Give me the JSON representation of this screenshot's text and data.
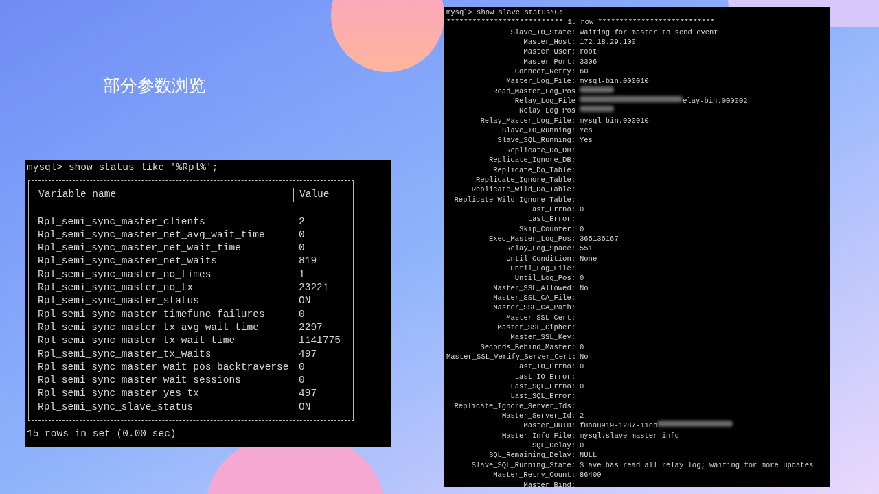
{
  "slide": {
    "title": "部分参数浏览"
  },
  "status_terminal": {
    "command": "mysql> show status like '%Rpl%';",
    "columns": [
      "Variable_name",
      "Value"
    ],
    "rows": [
      {
        "name": "Rpl_semi_sync_master_clients",
        "value": "2"
      },
      {
        "name": "Rpl_semi_sync_master_net_avg_wait_time",
        "value": "0"
      },
      {
        "name": "Rpl_semi_sync_master_net_wait_time",
        "value": "0"
      },
      {
        "name": "Rpl_semi_sync_master_net_waits",
        "value": "819"
      },
      {
        "name": "Rpl_semi_sync_master_no_times",
        "value": "1"
      },
      {
        "name": "Rpl_semi_sync_master_no_tx",
        "value": "23221"
      },
      {
        "name": "Rpl_semi_sync_master_status",
        "value": "ON"
      },
      {
        "name": "Rpl_semi_sync_master_timefunc_failures",
        "value": "0"
      },
      {
        "name": "Rpl_semi_sync_master_tx_avg_wait_time",
        "value": "2297"
      },
      {
        "name": "Rpl_semi_sync_master_tx_wait_time",
        "value": "1141775"
      },
      {
        "name": "Rpl_semi_sync_master_tx_waits",
        "value": "497"
      },
      {
        "name": "Rpl_semi_sync_master_wait_pos_backtraverse",
        "value": "0"
      },
      {
        "name": "Rpl_semi_sync_master_wait_sessions",
        "value": "0"
      },
      {
        "name": "Rpl_semi_sync_master_yes_tx",
        "value": "497"
      },
      {
        "name": "Rpl_semi_sync_slave_status",
        "value": "ON"
      }
    ],
    "footer": "15 rows in set (0.00 sec)"
  },
  "slave_terminal": {
    "command": "mysql> show slave status\\G:",
    "row_header": "*************************** 1. row ***************************",
    "fields": [
      {
        "kind": "plain",
        "label": "Slave_IO_State:",
        "value": "Waiting for master to send event"
      },
      {
        "kind": "plain",
        "label": "Master_Host:",
        "value": "172.18.29.100"
      },
      {
        "kind": "plain",
        "label": "Master_User:",
        "value": "root"
      },
      {
        "kind": "plain",
        "label": "Master_Port:",
        "value": "3306"
      },
      {
        "kind": "plain",
        "label": "Connect_Retry:",
        "value": "60"
      },
      {
        "kind": "plain",
        "label": "Master_Log_File:",
        "value": "mysql-bin.000010"
      },
      {
        "kind": "blurred",
        "label": "Read_Master_Log_Pos"
      },
      {
        "kind": "blurred_before",
        "label": "Relay_Log_File",
        "value": "elay-bin.000002"
      },
      {
        "kind": "blurred",
        "label": "Relay_Log_Pos"
      },
      {
        "kind": "plain",
        "label": "Relay_Master_Log_File:",
        "value": "mysql-bin.000010"
      },
      {
        "kind": "plain",
        "label": "Slave_IO_Running:",
        "value": "Yes"
      },
      {
        "kind": "plain",
        "label": "Slave_SQL_Running:",
        "value": "Yes"
      },
      {
        "kind": "plain",
        "label": "Replicate_Do_DB:"
      },
      {
        "kind": "plain",
        "label": "Replicate_Ignore_DB:"
      },
      {
        "kind": "plain",
        "label": "Replicate_Do_Table:"
      },
      {
        "kind": "plain",
        "label": "Replicate_Ignore_Table:"
      },
      {
        "kind": "plain",
        "label": "Replicate_Wild_Do_Table:"
      },
      {
        "kind": "plain",
        "label": "Replicate_Wild_Ignore_Table:"
      },
      {
        "kind": "plain",
        "label": "Last_Errno:",
        "value": "0"
      },
      {
        "kind": "plain",
        "label": "Last_Error:"
      },
      {
        "kind": "plain",
        "label": "Skip_Counter:",
        "value": "0"
      },
      {
        "kind": "plain",
        "label": "Exec_Master_Log_Pos:",
        "value": "365136167"
      },
      {
        "kind": "plain",
        "label": "Relay_Log_Space:",
        "value": "551"
      },
      {
        "kind": "plain",
        "label": "Until_Condition:",
        "value": "None"
      },
      {
        "kind": "plain",
        "label": "Until_Log_File:"
      },
      {
        "kind": "plain",
        "label": "Until_Log_Pos:",
        "value": "0"
      },
      {
        "kind": "plain",
        "label": "Master_SSL_Allowed:",
        "value": "No"
      },
      {
        "kind": "plain",
        "label": "Master_SSL_CA_File:"
      },
      {
        "kind": "plain",
        "label": "Master_SSL_CA_Path:"
      },
      {
        "kind": "plain",
        "label": "Master_SSL_Cert:"
      },
      {
        "kind": "plain",
        "label": "Master_SSL_Cipher:"
      },
      {
        "kind": "plain",
        "label": "Master_SSL_Key:"
      },
      {
        "kind": "plain",
        "label": "Seconds_Behind_Master:",
        "value": "0"
      },
      {
        "kind": "plain",
        "label": "Master_SSL_Verify_Server_Cert:",
        "value": "No"
      },
      {
        "kind": "plain",
        "label": "Last_IO_Errno:",
        "value": "0"
      },
      {
        "kind": "plain",
        "label": "Last_IO_Error:"
      },
      {
        "kind": "plain",
        "label": "Last_SQL_Errno:",
        "value": "0"
      },
      {
        "kind": "plain",
        "label": "Last_SQL_Error:"
      },
      {
        "kind": "plain",
        "label": "Replicate_Ignore_Server_Ids:"
      },
      {
        "kind": "plain",
        "label": "Master_Server_Id:",
        "value": "2"
      },
      {
        "kind": "blurred_after",
        "label": "Master_UUID:",
        "value": "f8aa8919-1287-11eb"
      },
      {
        "kind": "plain",
        "label": "Master_Info_File:",
        "value": "mysql.slave_master_info"
      },
      {
        "kind": "plain",
        "label": "SQL_Delay:",
        "value": "0"
      },
      {
        "kind": "plain",
        "label": "SQL_Remaining_Delay:",
        "value": "NULL"
      },
      {
        "kind": "plain",
        "label": "Slave_SQL_Running_State:",
        "value": "Slave has read all relay log; waiting for more updates"
      },
      {
        "kind": "plain",
        "label": "Master_Retry_Count:",
        "value": "86400"
      },
      {
        "kind": "plain",
        "label": "Master_Bind:"
      }
    ]
  }
}
